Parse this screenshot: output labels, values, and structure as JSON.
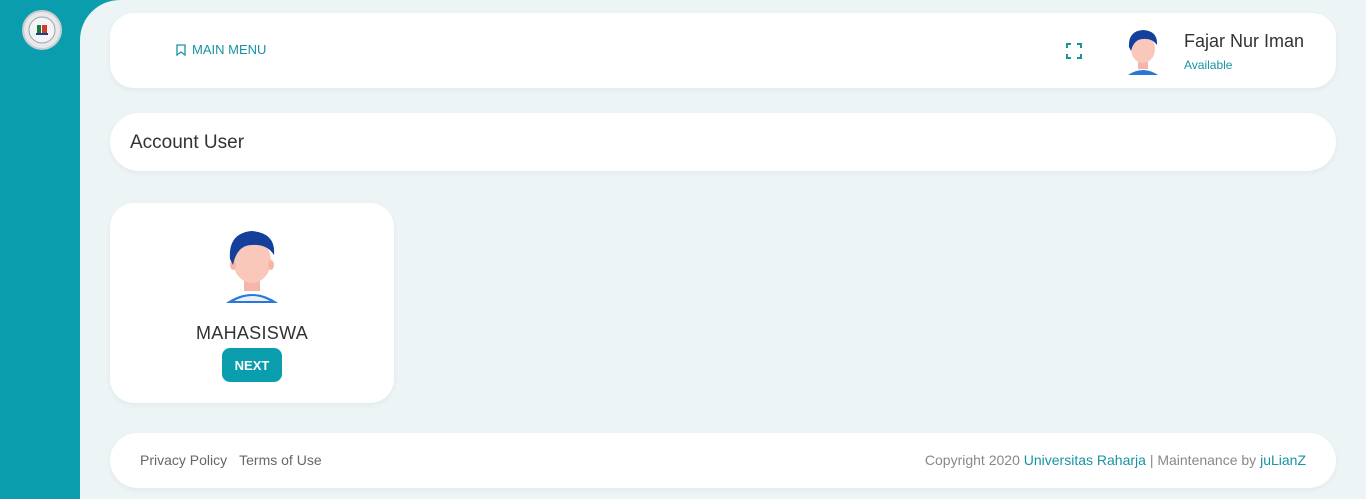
{
  "header": {
    "main_menu_label": "MAIN MENU",
    "user": {
      "name": "Fajar Nur Iman",
      "status": "Available"
    }
  },
  "page": {
    "title": "Account User"
  },
  "roles": [
    {
      "name": "MAHASISWA",
      "button_label": "NEXT"
    }
  ],
  "footer": {
    "links": [
      "Privacy Policy",
      "Terms of Use"
    ],
    "copyright_prefix": "Copyright 2020",
    "org_link": "Universitas Raharja",
    "separator": "| Maintenance by",
    "maintainer_link": "juLianZ"
  },
  "colors": {
    "accent": "#0a9dae",
    "background": "#edf4f6",
    "link": "#1793a3"
  },
  "icons": [
    "university-logo-icon",
    "bookmark-icon",
    "fullscreen-icon",
    "user-avatar-icon"
  ]
}
